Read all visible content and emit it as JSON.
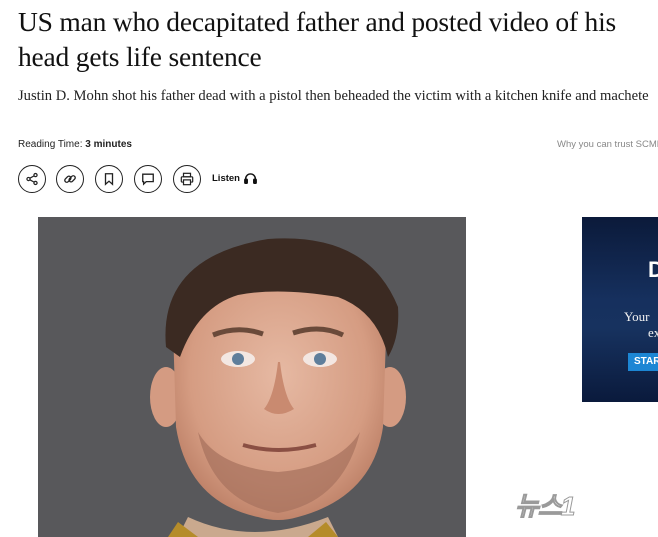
{
  "article": {
    "headline": "US man who decapitated father and posted video of his head gets life sentence",
    "subhead": "Justin D. Mohn shot his father dead with a pistol then beheaded the victim with a kitchen knife and machete",
    "reading_time_label": "Reading Time: ",
    "reading_time_value": "3 minutes",
    "trust_link": "Why you can trust SCMP"
  },
  "toolbar": {
    "buttons": [
      "share-icon",
      "link-icon",
      "bookmark-icon",
      "comment-icon",
      "print-icon"
    ],
    "listen_label": "Listen"
  },
  "ad": {
    "line1": "Your",
    "line2": "ex",
    "cta": "STAR",
    "letter": "D"
  },
  "watermark": {
    "text": "뉴스1"
  },
  "colors": {
    "photo_background": "#57575a",
    "ad_background": "#16305e",
    "ad_cta": "#1c86d4",
    "trust_link": "#888888"
  }
}
